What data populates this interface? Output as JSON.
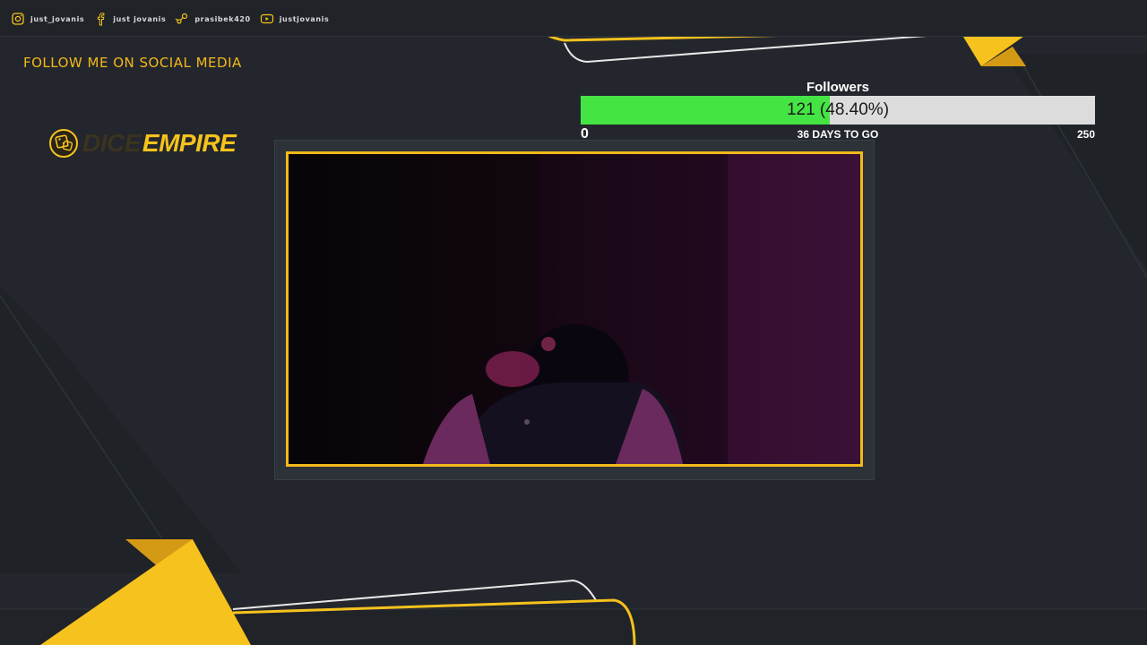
{
  "colors": {
    "background": "#23262c",
    "accent_yellow": "#f6c21d",
    "goal_fill": "#45e445",
    "goal_track": "#dcdcdc"
  },
  "socials": [
    {
      "icon": "instagram-icon",
      "handle": "JUST_JOVANIS"
    },
    {
      "icon": "facebook-icon",
      "handle": "JUST JOVANIS"
    },
    {
      "icon": "steam-icon",
      "handle": "PRASIBEK420"
    },
    {
      "icon": "youtube-icon",
      "handle": "JUSTJOVANIS"
    }
  ],
  "follow_heading": "FOLLOW ME ON SOCIAL MEDIA",
  "brand": {
    "icon": "dice-icon",
    "dim_text": "DICE",
    "text": "EMPIRE"
  },
  "goal": {
    "label": "Followers",
    "value_text": "121 (48.40%)",
    "current": 121,
    "target": 250,
    "progress_fraction": 0.484,
    "min_label": "0",
    "max_label": "250",
    "days_text": "36 DAYS TO GO"
  },
  "webcam": {
    "description_icon": "webcam-feed"
  }
}
